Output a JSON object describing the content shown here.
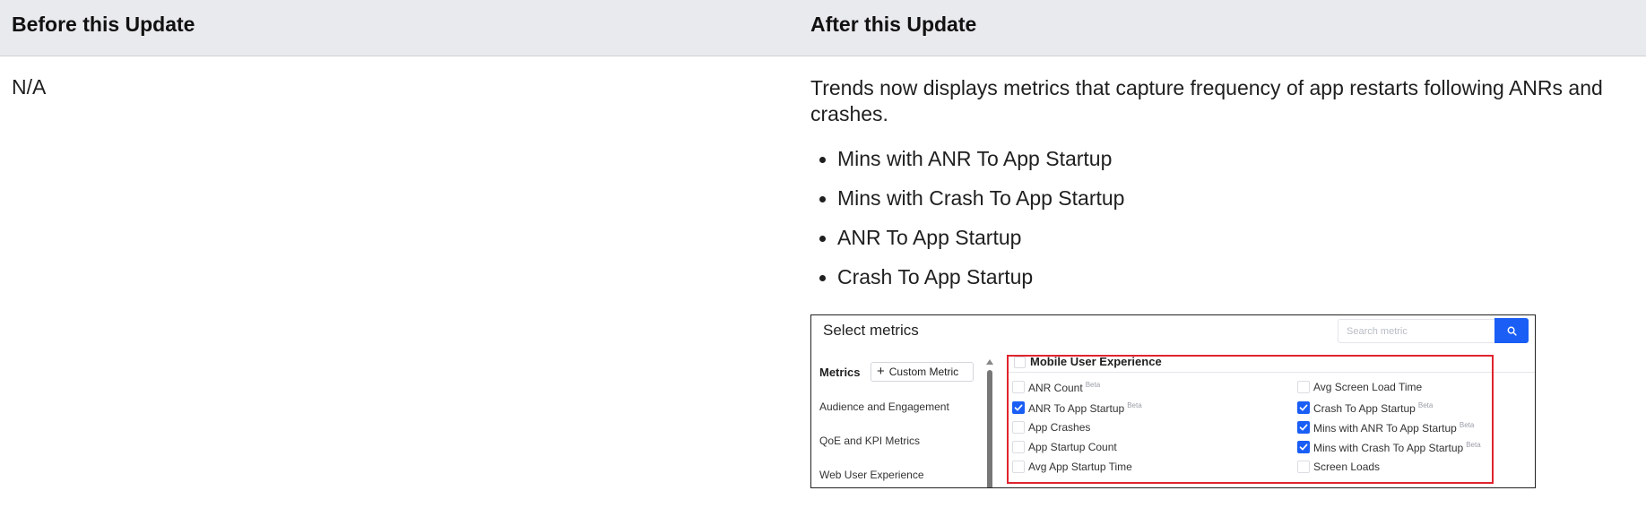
{
  "table": {
    "headers": [
      "Before this Update",
      "After this Update"
    ],
    "before": "N/A",
    "after": {
      "line1": "Trends now displays metrics that capture frequency of app restarts following ANRs and",
      "line2": "crashes.",
      "bullets": [
        "Mins with ANR To App Startup",
        "Mins with Crash To App Startup",
        "ANR To App Startup",
        "Crash To App Startup"
      ]
    }
  },
  "screenshot": {
    "title": "Select metrics",
    "search_placeholder": "Search metric",
    "metrics_label": "Metrics",
    "custom_metric_label": "Custom Metric",
    "categories": [
      "Audience and Engagement",
      "QoE and KPI Metrics",
      "Web User Experience"
    ],
    "group_title": "Mobile User Experience",
    "beta_label": "Beta",
    "left_items": [
      {
        "label": "ANR Count",
        "beta": true,
        "checked": false
      },
      {
        "label": "ANR To App Startup",
        "beta": true,
        "checked": true
      },
      {
        "label": "App Crashes",
        "beta": false,
        "checked": false
      },
      {
        "label": "App Startup Count",
        "beta": false,
        "checked": false
      },
      {
        "label": "Avg App Startup Time",
        "beta": false,
        "checked": false
      }
    ],
    "right_items": [
      {
        "label": "Avg Screen Load Time",
        "beta": false,
        "checked": false
      },
      {
        "label": "Crash To App Startup",
        "beta": true,
        "checked": true
      },
      {
        "label": "Mins with ANR To App Startup",
        "beta": true,
        "checked": true
      },
      {
        "label": "Mins with Crash To App Startup",
        "beta": true,
        "checked": true
      },
      {
        "label": "Screen Loads",
        "beta": false,
        "checked": false
      }
    ],
    "accent_color": "#1a5ef5",
    "highlight_color": "#e0242e"
  }
}
